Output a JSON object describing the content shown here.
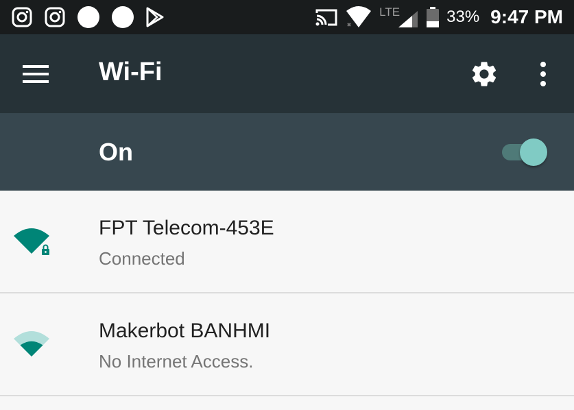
{
  "status_bar": {
    "notification_icons": [
      "instagram-icon",
      "instagram-icon",
      "dot-icon",
      "dot-icon",
      "play-store-icon"
    ],
    "system_icons": [
      "cast-icon",
      "wifi-signal-icon",
      "lte-signal-icon",
      "battery-icon"
    ],
    "network_type": "LTE",
    "battery_percent": "33%",
    "time": "9:47 PM"
  },
  "toolbar": {
    "title": "Wi-Fi",
    "icons": [
      "menu-icon",
      "gear-icon",
      "more-vert-icon"
    ]
  },
  "switch_bar": {
    "label": "On",
    "enabled": true
  },
  "networks": [
    {
      "name": "FPT Telecom-453E",
      "status": "Connected",
      "secured": true,
      "signal": "full"
    },
    {
      "name": "Makerbot BANHMI",
      "status": "No Internet Access.",
      "secured": false,
      "signal": "partial"
    }
  ],
  "colors": {
    "status_bar_bg": "#191c1d",
    "toolbar_bg": "#263237",
    "switch_bar_bg": "#37474f",
    "accent": "#008577",
    "toggle_thumb": "#80cbc4",
    "list_bg": "#f7f7f7"
  }
}
